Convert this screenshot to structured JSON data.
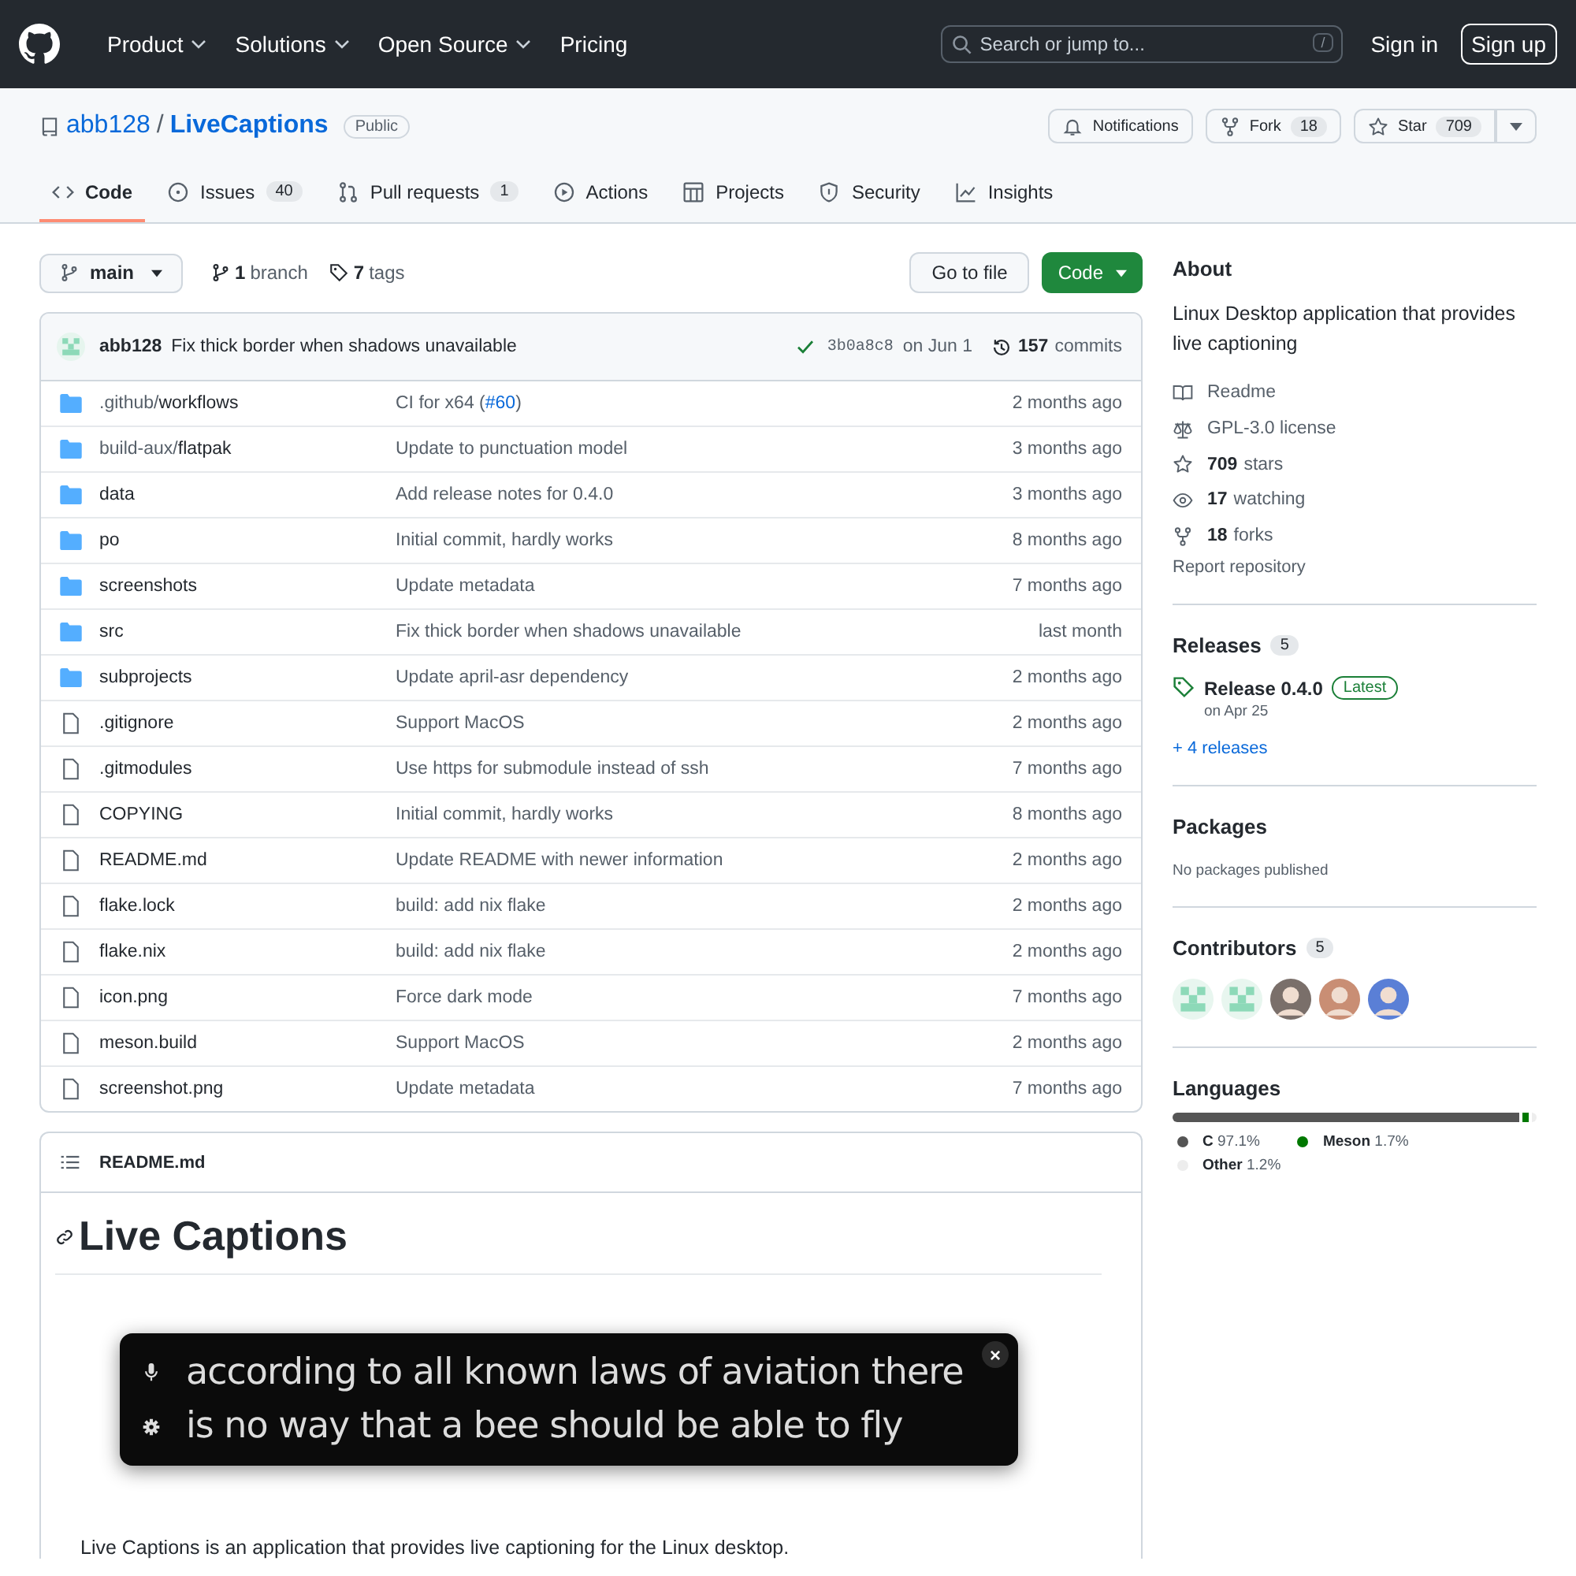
{
  "header": {
    "nav": [
      {
        "label": "Product",
        "has_menu": true
      },
      {
        "label": "Solutions",
        "has_menu": true
      },
      {
        "label": "Open Source",
        "has_menu": true
      },
      {
        "label": "Pricing",
        "has_menu": false
      }
    ],
    "search": {
      "placeholder": "Search or jump to...",
      "shortcut": "/"
    },
    "sign_in": "Sign in",
    "sign_up": "Sign up"
  },
  "repo": {
    "owner": "abb128",
    "separator": "/",
    "name": "LiveCaptions",
    "visibility": "Public",
    "actions": [
      {
        "kind": "bell",
        "label": "Notifications"
      },
      {
        "kind": "fork",
        "label": "Fork",
        "count": "18"
      },
      {
        "kind": "star",
        "label": "Star",
        "count": "709"
      }
    ],
    "tabs": [
      {
        "kind": "code",
        "label": "Code",
        "selected": true
      },
      {
        "kind": "issue",
        "label": "Issues",
        "count": "40",
        "selected": false
      },
      {
        "kind": "pull",
        "label": "Pull requests",
        "count": "1",
        "selected": false
      },
      {
        "kind": "play",
        "label": "Actions",
        "selected": false
      },
      {
        "kind": "table",
        "label": "Projects",
        "selected": false
      },
      {
        "kind": "shield",
        "label": "Security",
        "selected": false
      },
      {
        "kind": "graph",
        "label": "Insights",
        "selected": false
      }
    ]
  },
  "toolbar": {
    "branch": "main",
    "branches_count": "1",
    "branches_label": "branch",
    "tags_count": "7",
    "tags_label": "tags",
    "go_to_file": "Go to file",
    "code_button": "Code"
  },
  "last_commit": {
    "author": "abb128",
    "message": "Fix thick border when shadows unavailable",
    "hash": "3b0a8c8",
    "date": "on Jun 1",
    "commits_count": "157",
    "commits_label": "commits"
  },
  "files": [
    {
      "kind": "folder",
      "prefix": ".github/",
      "name": "workflows",
      "message": "CI for x64 (",
      "link": "#60",
      "message_end": ")",
      "age": "2 months ago"
    },
    {
      "kind": "folder",
      "prefix": "build-aux/",
      "name": "flatpak",
      "message": "Update to punctuation model",
      "age": "3 months ago"
    },
    {
      "kind": "folder",
      "name": "data",
      "message": "Add release notes for 0.4.0",
      "age": "3 months ago"
    },
    {
      "kind": "folder",
      "name": "po",
      "message": "Initial commit, hardly works",
      "age": "8 months ago"
    },
    {
      "kind": "folder",
      "name": "screenshots",
      "message": "Update metadata",
      "age": "7 months ago"
    },
    {
      "kind": "folder",
      "name": "src",
      "message": "Fix thick border when shadows unavailable",
      "age": "last month"
    },
    {
      "kind": "folder",
      "name": "subprojects",
      "message": "Update april-asr dependency",
      "age": "2 months ago"
    },
    {
      "kind": "file",
      "name": ".gitignore",
      "message": "Support MacOS",
      "age": "2 months ago"
    },
    {
      "kind": "file",
      "name": ".gitmodules",
      "message": "Use https for submodule instead of ssh",
      "age": "7 months ago"
    },
    {
      "kind": "file",
      "name": "COPYING",
      "message": "Initial commit, hardly works",
      "age": "8 months ago"
    },
    {
      "kind": "file",
      "name": "README.md",
      "message": "Update README with newer information",
      "age": "2 months ago"
    },
    {
      "kind": "file",
      "name": "flake.lock",
      "message": "build: add nix flake",
      "age": "2 months ago"
    },
    {
      "kind": "file",
      "name": "flake.nix",
      "message": "build: add nix flake",
      "age": "2 months ago"
    },
    {
      "kind": "file",
      "name": "icon.png",
      "message": "Force dark mode",
      "age": "7 months ago"
    },
    {
      "kind": "file",
      "name": "meson.build",
      "message": "Support MacOS",
      "age": "2 months ago"
    },
    {
      "kind": "file",
      "name": "screenshot.png",
      "message": "Update metadata",
      "age": "7 months ago"
    }
  ],
  "readme": {
    "filename": "README.md",
    "title": "Live Captions",
    "caption_window": {
      "lines": [
        {
          "kind": "mic",
          "text": "according to all known laws of aviation there"
        },
        {
          "kind": "gear",
          "text": "is no way that a bee should be able to fly"
        }
      ],
      "close": "×"
    },
    "paragraph": "Live Captions is an application that provides live captioning for the Linux desktop."
  },
  "sidebar": {
    "about": {
      "title": "About",
      "description": "Linux Desktop application that provides live captioning",
      "items": [
        {
          "kind": "book",
          "label": "Readme"
        },
        {
          "kind": "scale",
          "label": "GPL-3.0 license"
        },
        {
          "kind": "star",
          "count": "709",
          "label": "stars"
        },
        {
          "kind": "eye",
          "count": "17",
          "label": "watching"
        },
        {
          "kind": "fork",
          "count": "18",
          "label": "forks"
        }
      ],
      "report": "Report repository"
    },
    "releases": {
      "title": "Releases",
      "count": "5",
      "latest": {
        "name": "Release 0.4.0",
        "badge": "Latest",
        "date": "on Apr 25"
      },
      "more": "+ 4 releases"
    },
    "packages": {
      "title": "Packages",
      "empty": "No packages published"
    },
    "contributors": {
      "title": "Contributors",
      "count": "5",
      "avatars": [
        {
          "kind": "identicon"
        },
        {
          "kind": "identicon"
        },
        {
          "kind": "photo"
        },
        {
          "kind": "photo"
        },
        {
          "kind": "photo"
        }
      ]
    },
    "languages": {
      "title": "Languages",
      "items": [
        {
          "name": "C",
          "share": "97.1%",
          "level": 0.971,
          "color": "#555555"
        },
        {
          "name": "Meson",
          "share": "1.7%",
          "level": 0.017,
          "color": "#007800"
        },
        {
          "name": "Other",
          "share": "1.2%",
          "level": 0.012,
          "color": "#ededed"
        }
      ]
    }
  }
}
